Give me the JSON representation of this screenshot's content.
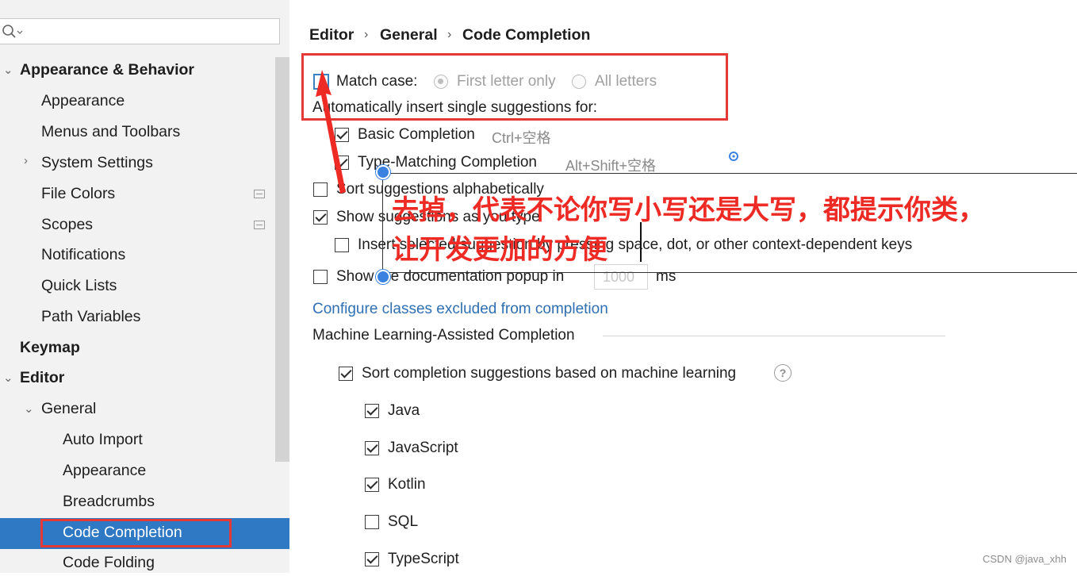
{
  "search": {
    "placeholder": ""
  },
  "tree": {
    "appearance_behavior": "Appearance & Behavior",
    "appearance": "Appearance",
    "menus_toolbars": "Menus and Toolbars",
    "system_settings": "System Settings",
    "file_colors": "File Colors",
    "scopes": "Scopes",
    "notifications": "Notifications",
    "quick_lists": "Quick Lists",
    "path_variables": "Path Variables",
    "keymap": "Keymap",
    "editor": "Editor",
    "general": "General",
    "auto_import": "Auto Import",
    "general_appearance": "Appearance",
    "breadcrumbs": "Breadcrumbs",
    "code_completion": "Code Completion",
    "code_folding": "Code Folding"
  },
  "breadcrumb": {
    "editor": "Editor",
    "general": "General",
    "code_completion": "Code Completion"
  },
  "settings": {
    "match_case_label": "Match case:",
    "match_case_checked": false,
    "first_letter_only": "First letter only",
    "all_letters": "All letters",
    "auto_insert_heading": "Automatically insert single suggestions for:",
    "basic_completion": "Basic Completion",
    "basic_completion_shortcut": "Ctrl+空格",
    "type_matching": "Type-Matching Completion",
    "type_matching_shortcut": "Alt+Shift+空格",
    "sort_alpha": "Sort suggestions alphabetically",
    "show_as_you_type": "Show suggestions as you type",
    "insert_selected": "Insert selected suggestion by pressing space, dot, or other context-dependent keys",
    "show_doc_popup": "Show the documentation popup in",
    "doc_popup_ms": "1000",
    "ms_unit": "ms",
    "configure_link": "Configure classes excluded from completion",
    "ml_heading": "Machine Learning-Assisted Completion",
    "ml_sort": "Sort completion suggestions based on machine learning",
    "help": "?",
    "langs": [
      {
        "name": "Java",
        "checked": true
      },
      {
        "name": "JavaScript",
        "checked": true
      },
      {
        "name": "Kotlin",
        "checked": true
      },
      {
        "name": "SQL",
        "checked": false
      },
      {
        "name": "TypeScript",
        "checked": true
      }
    ]
  },
  "annotation": {
    "line1": "去掉，代表不论你写小写还是大写，都提示你类，",
    "line2": "让开发更加的方便",
    "color": "#ee2a24"
  },
  "watermark": "CSDN @java_xhh"
}
